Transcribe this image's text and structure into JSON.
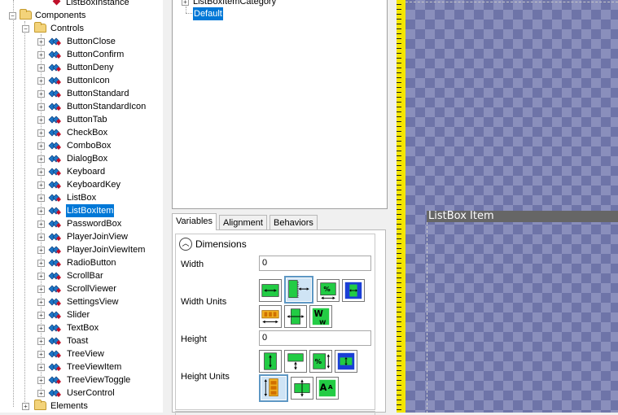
{
  "tree": {
    "top_item": "ListBoxInstance",
    "components_label": "Components",
    "controls_label": "Controls",
    "controls": [
      "ButtonClose",
      "ButtonConfirm",
      "ButtonDeny",
      "ButtonIcon",
      "ButtonStandard",
      "ButtonStandardIcon",
      "ButtonTab",
      "CheckBox",
      "ComboBox",
      "DialogBox",
      "Keyboard",
      "KeyboardKey",
      "ListBox",
      "ListBoxItem",
      "PasswordBox",
      "PlayerJoinView",
      "PlayerJoinViewItem",
      "RadioButton",
      "ScrollBar",
      "ScrollViewer",
      "SettingsView",
      "Slider",
      "TextBox",
      "Toast",
      "TreeView",
      "TreeViewItem",
      "TreeViewToggle",
      "UserControl"
    ],
    "selected": "ListBoxItem",
    "elements_label": "Elements"
  },
  "states": {
    "category": "ListBoxItemCategory",
    "default": "Default"
  },
  "tabs": [
    "Variables",
    "Alignment",
    "Behaviors"
  ],
  "props": {
    "section": "Dimensions",
    "width_label": "Width",
    "width_value": "0",
    "width_units_label": "Width Units",
    "height_label": "Height",
    "height_value": "0",
    "height_units_label": "Height Units"
  },
  "canvas": {
    "item_label": "ListBox Item"
  },
  "colors": {
    "selection": "#0078d7",
    "canvas_bg": "#6e74a8",
    "ruler": "#f4e600"
  }
}
